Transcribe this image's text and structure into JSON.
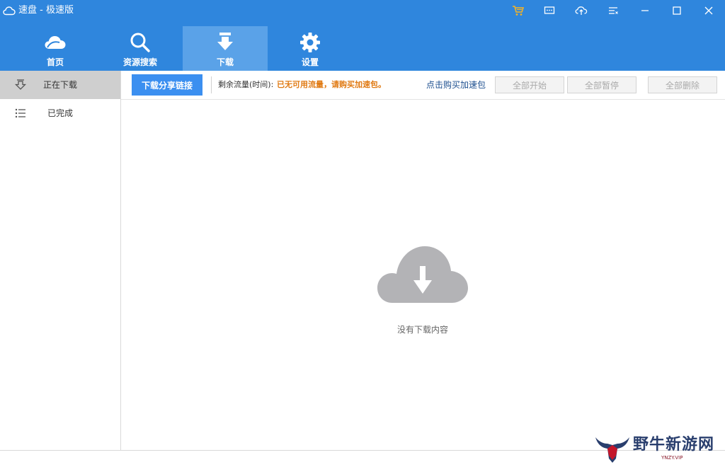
{
  "window": {
    "title": "速盘 - 极速版",
    "icons": [
      "cart-icon",
      "message-icon",
      "upload-icon",
      "menu-icon",
      "minimize-icon",
      "maximize-icon",
      "close-icon"
    ]
  },
  "colors": {
    "header_bg": "#2f86dd",
    "nav_active_bg": "#5aa2e8",
    "primary_button": "#3b8ff0",
    "warning_text": "#e07a13",
    "link_text": "#1d4f8f"
  },
  "nav": {
    "items": [
      {
        "label": "首页",
        "icon": "cloud-icon"
      },
      {
        "label": "资源搜索",
        "icon": "search-icon"
      },
      {
        "label": "下载",
        "icon": "download-icon",
        "active": true
      },
      {
        "label": "设置",
        "icon": "gear-icon"
      }
    ]
  },
  "sidebar": {
    "items": [
      {
        "label": "正在下载",
        "icon": "downloading-icon",
        "active": true
      },
      {
        "label": "已完成",
        "icon": "list-icon"
      }
    ]
  },
  "toolbar": {
    "share_link_button": "下载分享链接",
    "traffic_label": "剩余流量(时间):",
    "traffic_value": "已无可用流量，请购买加速包。",
    "buy_link": "点击购买加速包",
    "start_all": "全部开始",
    "pause_all": "全部暂停",
    "delete_all": "全部删除"
  },
  "main": {
    "empty_text": "没有下载内容"
  },
  "watermark": {
    "text": "野牛新游网",
    "sub": "YNZY.VIP"
  }
}
